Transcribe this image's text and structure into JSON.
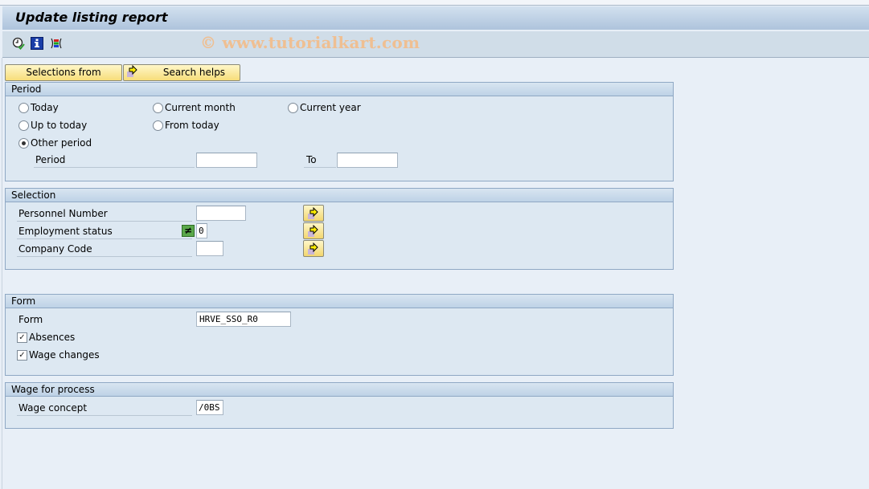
{
  "window": {
    "title": "Update listing report",
    "watermark": "© www.tutorialkart.com"
  },
  "toolbar": {
    "icons": [
      "execute-clock-icon",
      "info-icon",
      "variant-list-icon"
    ]
  },
  "buttons": {
    "selections_from": "Selections from",
    "search_helps": "Search helps"
  },
  "period": {
    "title": "Period",
    "options": [
      {
        "label": "Today",
        "selected": false
      },
      {
        "label": "Current month",
        "selected": false
      },
      {
        "label": "Current year",
        "selected": false
      },
      {
        "label": "Up to today",
        "selected": false
      },
      {
        "label": "From today",
        "selected": false
      },
      {
        "label": "Other period",
        "selected": true
      }
    ],
    "period_label": "Period",
    "period_from_value": "",
    "to_label": "To",
    "period_to_value": ""
  },
  "selection": {
    "title": "Selection",
    "fields": [
      {
        "label": "Personnel Number",
        "value": ""
      },
      {
        "label": "Employment status",
        "value": "0",
        "option": "≠"
      },
      {
        "label": "Company Code",
        "value": ""
      }
    ]
  },
  "form": {
    "title": "Form",
    "form_label": "Form",
    "form_value": "HRVE_SSO_R0",
    "absences_label": "Absences",
    "absences_checked": true,
    "wage_changes_label": "Wage changes",
    "wage_changes_checked": true
  },
  "wage": {
    "title": "Wage for process",
    "wage_concept_label": "Wage concept",
    "wage_concept_value": "/0BS"
  }
}
